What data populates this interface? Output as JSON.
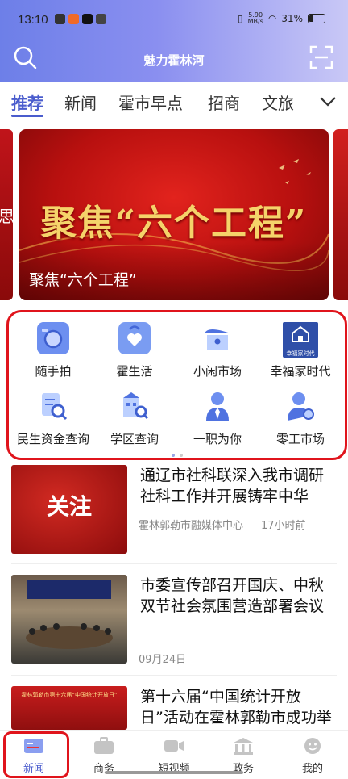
{
  "status_bar": {
    "time": "13:10",
    "net_speed": "5.90",
    "net_unit": "MB/s",
    "battery": "31%"
  },
  "header": {
    "title": "魅力霍林河",
    "search_icon": "search-icon",
    "scan_icon": "scan-icon"
  },
  "tabs": [
    {
      "label": "推荐",
      "active": true
    },
    {
      "label": "新闻"
    },
    {
      "label": "霍市早点"
    },
    {
      "label": "招商"
    },
    {
      "label": "文旅"
    }
  ],
  "banner": {
    "headline": "聚焦“六个工程”",
    "caption": "聚焦“六个工程”",
    "left_peek": "思"
  },
  "features": [
    {
      "label": "随手拍",
      "icon": "camera-icon"
    },
    {
      "label": "霍生活",
      "icon": "heart-bag-icon"
    },
    {
      "label": "小闲市场",
      "icon": "market-stall-icon"
    },
    {
      "label": "幸福家时代",
      "icon": "happy-home-icon",
      "badge": "幸福家时代"
    },
    {
      "label": "民生资金查询",
      "icon": "document-search-icon"
    },
    {
      "label": "学区查询",
      "icon": "school-search-icon"
    },
    {
      "label": "一职为你",
      "icon": "person-tie-icon"
    },
    {
      "label": "零工市场",
      "icon": "person-wrench-icon"
    }
  ],
  "news": [
    {
      "title": "通辽市社科联深入我市调研社科工作并开展铸牢中华民…",
      "thumb_text": "关注",
      "source": "霍林郭勒市融媒体中心",
      "time": "17小时前"
    },
    {
      "title": "市委宣传部召开国庆、中秋双节社会氛围营造部署会议",
      "date": "09月24日"
    },
    {
      "title": "第十六届“中国统计开放日”活动在霍林郭勒市成功举办",
      "thumb_caption": "霍林郭勒市第十六届“中国统计开放日”"
    }
  ],
  "bottom_nav": [
    {
      "label": "新闻",
      "icon": "news-icon",
      "active": true
    },
    {
      "label": "商务",
      "icon": "briefcase-icon"
    },
    {
      "label": "短视频",
      "icon": "video-camera-icon"
    },
    {
      "label": "政务",
      "icon": "government-building-icon"
    },
    {
      "label": "我的",
      "icon": "smiley-user-icon"
    }
  ],
  "colors": {
    "accent": "#4a5ccd",
    "highlight_border": "#e0141c"
  }
}
